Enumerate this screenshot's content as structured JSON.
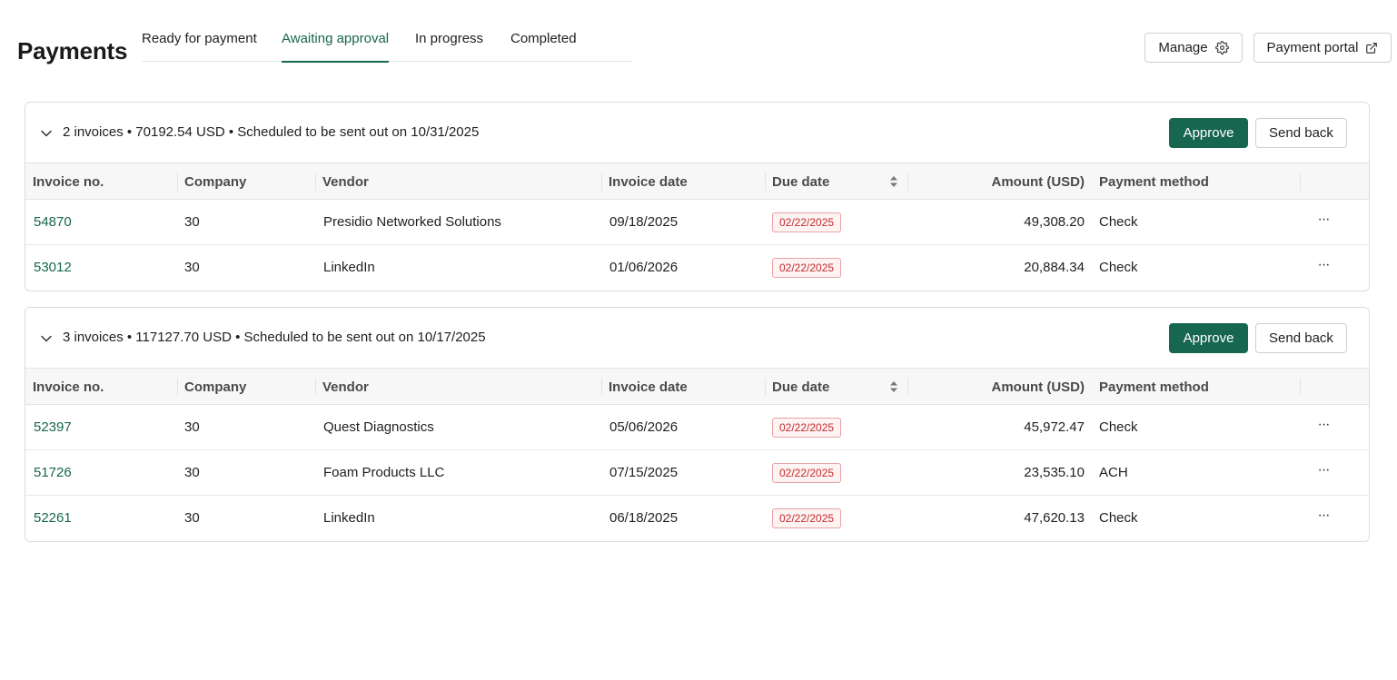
{
  "page": {
    "title": "Payments"
  },
  "tabs": [
    {
      "label": "Ready for payment",
      "active": false
    },
    {
      "label": "Awaiting approval",
      "active": true
    },
    {
      "label": "In progress",
      "active": false
    },
    {
      "label": "Completed",
      "active": false
    }
  ],
  "header": {
    "manage_label": "Manage",
    "manage_icon": "gear-icon",
    "portal_label": "Payment portal",
    "portal_icon": "external-link-icon"
  },
  "colors": {
    "accent": "#176650",
    "due_badge_text": "#c42b2b",
    "due_badge_border": "#e8a3a3"
  },
  "columns": {
    "invoice_no": "Invoice no.",
    "company": "Company",
    "vendor": "Vendor",
    "invoice_date": "Invoice date",
    "due_date": "Due date",
    "amount": "Amount (USD)",
    "payment_method": "Payment method"
  },
  "groups": [
    {
      "summary": "2 invoices • 70192.54 USD • Scheduled to be sent out on 10/31/2025",
      "approve_label": "Approve",
      "send_back_label": "Send back",
      "rows": [
        {
          "invoice_no": "54870",
          "company": "30",
          "vendor": "Presidio Networked Solutions",
          "invoice_date": "09/18/2025",
          "due_date": "02/22/2025",
          "amount": "49,308.20",
          "payment_method": "Check",
          "more": "···"
        },
        {
          "invoice_no": "53012",
          "company": "30",
          "vendor": "LinkedIn",
          "invoice_date": "01/06/2026",
          "due_date": "02/22/2025",
          "amount": "20,884.34",
          "payment_method": "Check",
          "more": "···"
        }
      ]
    },
    {
      "summary": "3 invoices • 117127.70 USD • Scheduled to be sent out on 10/17/2025",
      "approve_label": "Approve",
      "send_back_label": "Send back",
      "rows": [
        {
          "invoice_no": "52397",
          "company": "30",
          "vendor": "Quest Diagnostics",
          "invoice_date": "05/06/2026",
          "due_date": "02/22/2025",
          "amount": "45,972.47",
          "payment_method": "Check",
          "more": "···"
        },
        {
          "invoice_no": "51726",
          "company": "30",
          "vendor": "Foam Products LLC",
          "invoice_date": "07/15/2025",
          "due_date": "02/22/2025",
          "amount": "23,535.10",
          "payment_method": "ACH",
          "more": "···"
        },
        {
          "invoice_no": "52261",
          "company": "30",
          "vendor": "LinkedIn",
          "invoice_date": "06/18/2025",
          "due_date": "02/22/2025",
          "amount": "47,620.13",
          "payment_method": "Check",
          "more": "···"
        }
      ]
    }
  ]
}
